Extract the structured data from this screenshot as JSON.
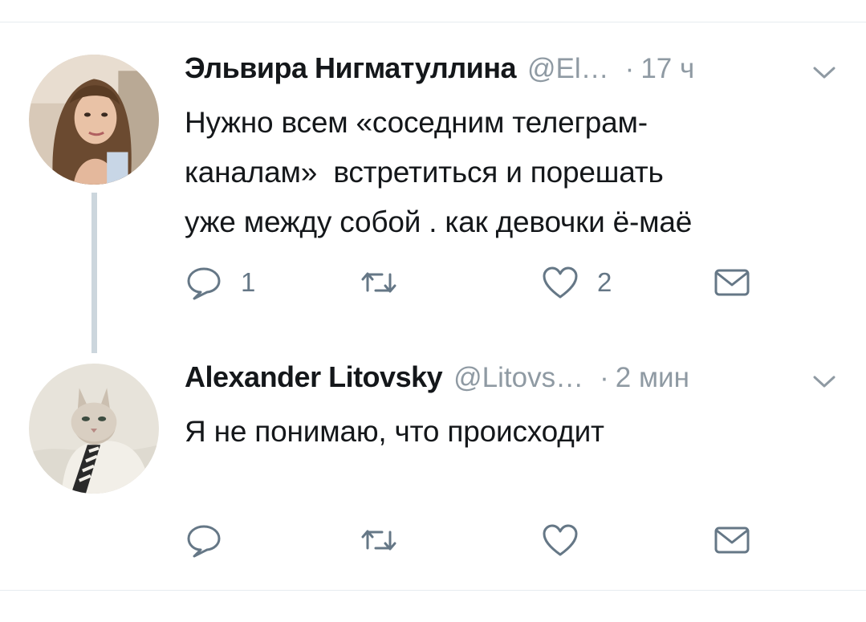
{
  "colors": {
    "text": "#14171a",
    "secondary": "#8f9aa3",
    "icon": "#657786",
    "thread_line": "#ccd6dd",
    "divider": "#e6ecf0"
  },
  "tweets": [
    {
      "author_name": "Эльвира Нигматуллина",
      "handle": "@El…",
      "separator": "·",
      "time": "17 ч",
      "text_lines": [
        "Нужно всем «соседним телеграм-",
        "каналам»  встретиться и порешать",
        "уже между собой . как девочки ё-маё"
      ],
      "reply_count": "1",
      "retweet_count": "",
      "like_count": "2",
      "avatar_icon": "avatar-woman-photo"
    },
    {
      "author_name": "Alexander Litovsky",
      "handle": "@Litovs…",
      "separator": "·",
      "time": "2 мин",
      "text_lines": [
        "Я не понимаю, что происходит"
      ],
      "reply_count": "",
      "retweet_count": "",
      "like_count": "",
      "avatar_icon": "avatar-cat-photo"
    }
  ],
  "icons": {
    "reply": "reply-icon",
    "retweet": "retweet-icon",
    "like": "heart-icon",
    "dm": "envelope-icon",
    "menu": "chevron-down-icon"
  }
}
